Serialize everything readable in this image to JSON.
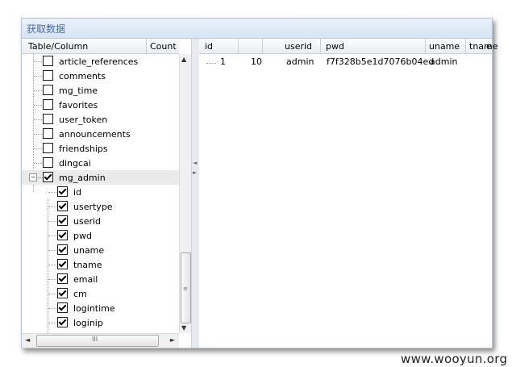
{
  "window": {
    "title": "获取数据"
  },
  "tree": {
    "header": {
      "col1": "Table/Column",
      "col2": "Count"
    },
    "items": [
      {
        "label": "article_references",
        "checked": false,
        "level": 0
      },
      {
        "label": "comments",
        "checked": false,
        "level": 0
      },
      {
        "label": "mg_time",
        "checked": false,
        "level": 0
      },
      {
        "label": "favorites",
        "checked": false,
        "level": 0
      },
      {
        "label": "user_token",
        "checked": false,
        "level": 0
      },
      {
        "label": "announcements",
        "checked": false,
        "level": 0
      },
      {
        "label": "friendships",
        "checked": false,
        "level": 0
      },
      {
        "label": "dingcai",
        "checked": false,
        "level": 0
      },
      {
        "label": "mg_admin",
        "checked": true,
        "level": 0,
        "expanded": true
      },
      {
        "label": "id",
        "checked": true,
        "level": 1
      },
      {
        "label": "usertype",
        "checked": true,
        "level": 1
      },
      {
        "label": "userid",
        "checked": true,
        "level": 1
      },
      {
        "label": "pwd",
        "checked": true,
        "level": 1
      },
      {
        "label": "uname",
        "checked": true,
        "level": 1
      },
      {
        "label": "tname",
        "checked": true,
        "level": 1
      },
      {
        "label": "email",
        "checked": true,
        "level": 1
      },
      {
        "label": "cm",
        "checked": true,
        "level": 1
      },
      {
        "label": "logintime",
        "checked": true,
        "level": 1
      },
      {
        "label": "loginip",
        "checked": true,
        "level": 1
      }
    ],
    "expander_symbol": "−"
  },
  "scroll": {
    "up": "▲",
    "down": "▼",
    "left": "◄",
    "right": "►",
    "grip_v": "≡",
    "grip_h": "III"
  },
  "splitter": {
    "arrow_left": "◄",
    "arrow_right": "►"
  },
  "grid": {
    "columns": [
      "id",
      "",
      "userid",
      "pwd",
      "uname",
      "tname",
      "e"
    ],
    "rows": [
      {
        "row_no": "1",
        "id": "10",
        "userid": "admin",
        "pwd": "f7f328b5e1d7076b04ed",
        "uname": "admin"
      }
    ]
  },
  "watermark": "www.wooyun.org"
}
